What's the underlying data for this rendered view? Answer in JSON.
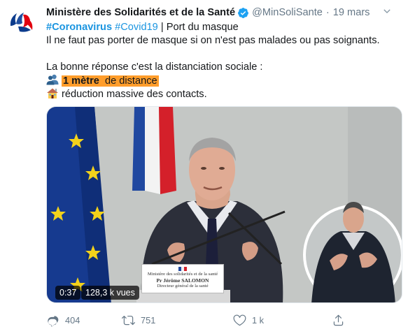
{
  "tweet": {
    "author_name": "Ministère des Solidarités et de la Santé",
    "handle": "@MinSoliSante",
    "separator": "·",
    "timestamp": "19 mars",
    "line1": {
      "hashtag1": "#Coronavirus",
      "hashtag2": "#Covid19",
      "rest": " | Port du masque"
    },
    "line2": "Il ne faut pas porter de masque si on n'est pas malades ou pas soignants.",
    "line3": "La bonne réponse c'est la distanciation sociale :",
    "line4": {
      "highlight_strong": "1 mètre",
      "highlight_rest": " de distance"
    },
    "line5": "réduction massive des contacts."
  },
  "video": {
    "duration": "0:37",
    "views": "128,3 k vues",
    "nameplate": {
      "org": "Ministère des solidarités et de la santé",
      "person": "Pr Jérôme SALOMON",
      "role": "Directeur général de la santé"
    }
  },
  "actions": {
    "reply_count": "404",
    "retweet_count": "751",
    "like_count": "1 k"
  },
  "icons": {
    "verified": "verified-badge-icon",
    "caret": "chevron-down-icon",
    "reply": "reply-icon",
    "retweet": "retweet-icon",
    "like": "heart-icon",
    "share": "share-icon",
    "people": "people-emoji-icon",
    "house": "house-emoji-icon"
  },
  "colors": {
    "link": "#1b95e0",
    "highlight": "#ff9d2b",
    "muted": "#657786",
    "text": "#14171a"
  }
}
